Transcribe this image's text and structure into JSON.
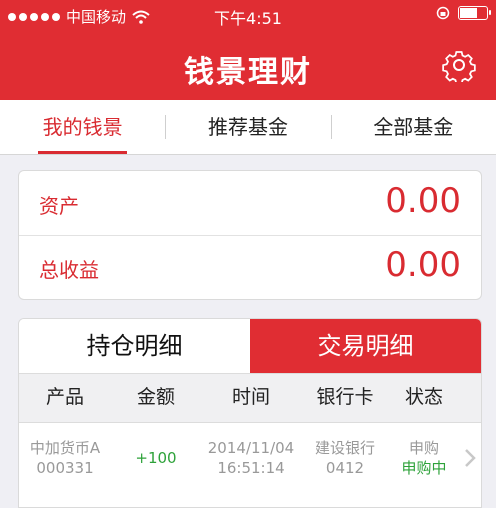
{
  "status_bar": {
    "carrier": "中国移动",
    "time": "下午4:51"
  },
  "nav": {
    "title": "钱景理财",
    "settings_icon": "gear-icon"
  },
  "tabs": [
    {
      "label": "我的钱景",
      "active": true
    },
    {
      "label": "推荐基金",
      "active": false
    },
    {
      "label": "全部基金",
      "active": false
    }
  ],
  "summary": {
    "assets_label": "资产",
    "assets_value": "0.00",
    "income_label": "总收益",
    "income_value": "0.00"
  },
  "segments": {
    "holdings": "持仓明细",
    "transactions": "交易明细",
    "active": "transactions"
  },
  "table": {
    "headers": [
      "产品",
      "金额",
      "时间",
      "银行卡",
      "状态"
    ],
    "rows": [
      {
        "product_name": "中加货币A",
        "product_code": "000331",
        "amount": "+100",
        "date": "2014/11/04",
        "time": "16:51:14",
        "bank": "建设银行",
        "card_tail": "0412",
        "type": "申购",
        "status": "申购中"
      }
    ]
  },
  "colors": {
    "brand_red": "#e02d33",
    "positive_green": "#2ea23a"
  }
}
